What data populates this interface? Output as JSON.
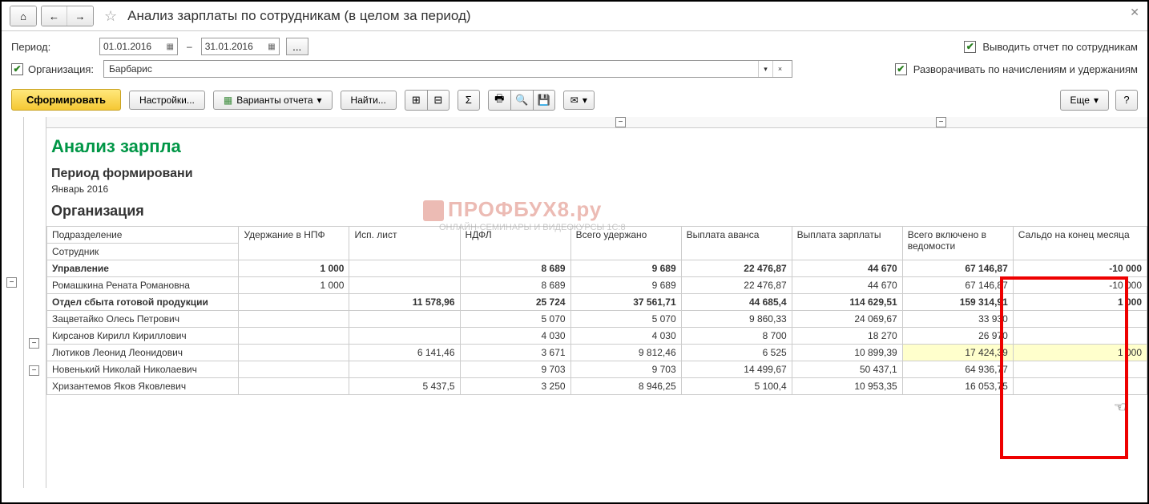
{
  "title": "Анализ зарплаты по сотрудникам (в целом за период)",
  "period_label": "Период:",
  "date_from": "01.01.2016",
  "date_to": "31.01.2016",
  "dash": "–",
  "org_label": "Организация:",
  "org_value": "Барбарис",
  "check_by_employees": "Выводить отчет по сотрудникам",
  "check_expand": "Разворачивать по начислениям и удержаниям",
  "btn_form": "Сформировать",
  "btn_settings": "Настройки...",
  "btn_variants": "Варианты отчета",
  "btn_find": "Найти...",
  "btn_more": "Еще",
  "report": {
    "title": "Анализ зарпла",
    "period_section": "Период формировани",
    "period_value": "Январь 2016",
    "org_section": "Организация"
  },
  "watermark": "ПРОФБУХ8.ру",
  "watermark_sub": "ОНЛАЙН-СЕМИНАРЫ И ВИДЕОКУРСЫ 1С:8",
  "columns": {
    "division": "Подразделение",
    "employee": "Сотрудник",
    "npf": "Удержание в НПФ",
    "isplist": "Исп. лист",
    "ndfl": "НДФЛ",
    "withheld": "Всего удержано",
    "advance": "Выплата аванса",
    "salary": "Выплата зарплаты",
    "included": "Всего включено в ведомости",
    "balance": "Сальдо на конец месяца"
  },
  "rows": [
    {
      "bold": true,
      "name": "Управление",
      "npf": "1 000",
      "isp": "",
      "ndfl": "8 689",
      "with": "9 689",
      "adv": "22 476,87",
      "sal": "44 670",
      "inc": "67 146,87",
      "bal": "-10 000"
    },
    {
      "bold": false,
      "name": "Ромашкина Рената Романовна",
      "npf": "1 000",
      "isp": "",
      "ndfl": "8 689",
      "with": "9 689",
      "adv": "22 476,87",
      "sal": "44 670",
      "inc": "67 146,87",
      "bal": "-10 000"
    },
    {
      "bold": true,
      "name": "Отдел сбыта готовой продукции",
      "npf": "",
      "isp": "11 578,96",
      "ndfl": "25 724",
      "with": "37 561,71",
      "adv": "44 685,4",
      "sal": "114 629,51",
      "inc": "159 314,91",
      "bal": "1 000"
    },
    {
      "bold": false,
      "name": "Зацветайко Олесь Петрович",
      "npf": "",
      "isp": "",
      "ndfl": "5 070",
      "with": "5 070",
      "adv": "9 860,33",
      "sal": "24 069,67",
      "inc": "33 930",
      "bal": ""
    },
    {
      "bold": false,
      "name": "Кирсанов Кирилл Кириллович",
      "npf": "",
      "isp": "",
      "ndfl": "4 030",
      "with": "4 030",
      "adv": "8 700",
      "sal": "18 270",
      "inc": "26 970",
      "bal": ""
    },
    {
      "bold": false,
      "name": "Лютиков Леонид Леонидович",
      "npf": "",
      "isp": "6 141,46",
      "ndfl": "3 671",
      "with": "9 812,46",
      "adv": "6 525",
      "sal": "10 899,39",
      "inc": "17 424,39",
      "bal": "1 000",
      "hl": true
    },
    {
      "bold": false,
      "name": "Новенький Николай Николаевич",
      "npf": "",
      "isp": "",
      "ndfl": "9 703",
      "with": "9 703",
      "adv": "14 499,67",
      "sal": "50 437,1",
      "inc": "64 936,77",
      "bal": ""
    },
    {
      "bold": false,
      "name": "Хризантемов Яков Яковлевич",
      "npf": "",
      "isp": "5 437,5",
      "ndfl": "3 250",
      "with": "8 946,25",
      "adv": "5 100,4",
      "sal": "10 953,35",
      "inc": "16 053,75",
      "bal": ""
    }
  ]
}
